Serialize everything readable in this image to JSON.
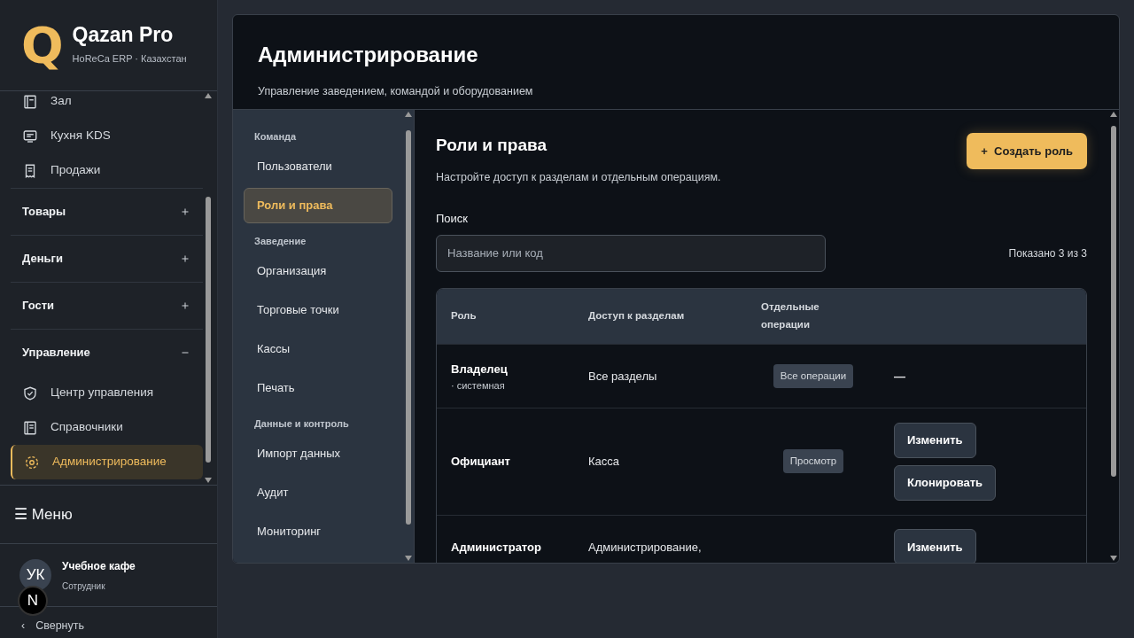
{
  "brand": {
    "logo": "Q",
    "name": "Qazan Pro",
    "tagline": "HoReCa ERP · Казахстан"
  },
  "sidebar": {
    "nav": [
      {
        "kind": "item",
        "label": "Зал",
        "selected": false
      },
      {
        "kind": "item",
        "label": "Кухня KDS",
        "selected": false
      },
      {
        "kind": "item",
        "label": "Продажи",
        "selected": false
      },
      {
        "kind": "group",
        "label": "Товары",
        "expanded": false
      },
      {
        "kind": "group",
        "label": "Деньги",
        "expanded": false
      },
      {
        "kind": "group",
        "label": "Гости",
        "expanded": false
      },
      {
        "kind": "group",
        "label": "Управление",
        "expanded": true,
        "children": [
          {
            "label": "Центр управления",
            "selected": false
          },
          {
            "label": "Справочники",
            "selected": false
          },
          {
            "label": "Администрирование",
            "selected": true
          }
        ]
      }
    ],
    "menu": "☰ Меню",
    "user": {
      "initials": "УК",
      "name": "Учебное кафе",
      "role": "Сотрудник"
    },
    "dev_badge": "N",
    "collapse": {
      "arrow": "‹",
      "label": "Свернуть"
    }
  },
  "page": {
    "title": "Администрирование",
    "subtitle": "Управление заведением, командой и оборудованием"
  },
  "subnav": [
    {
      "heading": "Команда",
      "items": [
        {
          "label": "Пользователи",
          "selected": false
        },
        {
          "label": "Роли и права",
          "selected": true
        }
      ]
    },
    {
      "heading": "Заведение",
      "items": [
        {
          "label": "Организация",
          "selected": false
        },
        {
          "label": "Торговые точки",
          "selected": false
        },
        {
          "label": "Кассы",
          "selected": false
        },
        {
          "label": "Печать",
          "selected": false
        }
      ]
    },
    {
      "heading": "Данные и контроль",
      "items": [
        {
          "label": "Импорт данных",
          "selected": false
        },
        {
          "label": "Аудит",
          "selected": false
        },
        {
          "label": "Мониторинг",
          "selected": false
        }
      ]
    }
  ],
  "section": {
    "title": "Роли и права",
    "subtitle": "Настройте доступ к разделам и отдельным операциям.",
    "create_button": "+  Создать роль",
    "search": {
      "label": "Поиск",
      "placeholder": "Название или код"
    },
    "count": "Показано 3 из 3"
  },
  "table": {
    "columns": [
      "Роль",
      "Доступ к разделам",
      "Отдельные операции"
    ],
    "rows": [
      {
        "role": "Владелец",
        "note": "· системная",
        "access": "Все разделы",
        "operations": "Все операции",
        "actions": [],
        "no_actions": "—"
      },
      {
        "role": "Официант",
        "access": "Касса",
        "operations": "Просмотр",
        "actions": [
          "Изменить",
          "Клонировать"
        ]
      },
      {
        "role": "Администратор",
        "access": "Администрирование,",
        "actions": [
          "Изменить"
        ]
      }
    ]
  }
}
